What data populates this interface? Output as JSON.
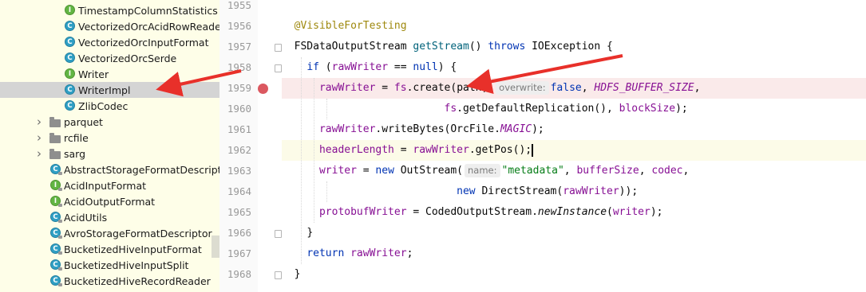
{
  "project_tree": {
    "items": [
      {
        "label": "TimestampColumnStatistics",
        "icon": "interface-icon",
        "badge": "I"
      },
      {
        "label": "VectorizedOrcAcidRowReader",
        "icon": "class-icon",
        "badge": "C"
      },
      {
        "label": "VectorizedOrcInputFormat",
        "icon": "class-icon",
        "badge": "C"
      },
      {
        "label": "VectorizedOrcSerde",
        "icon": "class-icon",
        "badge": "C"
      },
      {
        "label": "Writer",
        "icon": "interface-icon",
        "badge": "I"
      },
      {
        "label": "WriterImpl",
        "icon": "class-icon",
        "badge": "C",
        "selected": true
      },
      {
        "label": "ZlibCodec",
        "icon": "class-icon",
        "badge": "C"
      },
      {
        "label": "parquet",
        "icon": "folder-icon"
      },
      {
        "label": "rcfile",
        "icon": "folder-icon"
      },
      {
        "label": "sarg",
        "icon": "folder-icon"
      },
      {
        "label": "AbstractStorageFormatDescriptor",
        "icon": "class-icon",
        "badge": "C"
      },
      {
        "label": "AcidInputFormat",
        "icon": "interface-icon",
        "badge": "I"
      },
      {
        "label": "AcidOutputFormat",
        "icon": "interface-icon",
        "badge": "I"
      },
      {
        "label": "AcidUtils",
        "icon": "class-icon",
        "badge": "C"
      },
      {
        "label": "AvroStorageFormatDescriptor",
        "icon": "class-icon",
        "badge": "C"
      },
      {
        "label": "BucketizedHiveInputFormat",
        "icon": "class-icon",
        "badge": "C"
      },
      {
        "label": "BucketizedHiveInputSplit",
        "icon": "class-icon",
        "badge": "C"
      },
      {
        "label": "BucketizedHiveRecordReader",
        "icon": "class-icon",
        "badge": "C"
      }
    ]
  },
  "editor": {
    "line_numbers": [
      "1955",
      "1956",
      "1957",
      "1958",
      "1959",
      "1960",
      "1961",
      "1962",
      "1963",
      "1964",
      "1965",
      "1966",
      "1967",
      "1968"
    ],
    "breakpoint_line": "1959",
    "code": {
      "l1956_annotation": "@VisibleForTesting",
      "l1957_type": "FSDataOutputStream ",
      "l1957_method": "getStream",
      "l1957_parens": "() ",
      "l1957_throws": "throws",
      "l1957_rest": " IOException {",
      "l1958_if": "if",
      "l1958_open": " (",
      "l1958_field": "rawWriter",
      "l1958_eq": " == ",
      "l1958_null": "null",
      "l1958_close": ") {",
      "l1959_field": "rawWriter",
      "l1959_assign": " = ",
      "l1959_fs": "fs",
      "l1959_call": ".create(",
      "l1959_arg": "path,",
      "l1959_hint": "overwrite:",
      "l1959_false": "false",
      "l1959_comma": ", ",
      "l1959_const": "HDFS_BUFFER_SIZE",
      "l1959_end": ",",
      "l1960_fs": "fs",
      "l1960_rest": ".getDefaultReplication(), ",
      "l1960_field": "blockSize",
      "l1960_end": ");",
      "l1961_field": "rawWriter",
      "l1961_rest": ".writeBytes(OrcFile.",
      "l1961_const": "MAGIC",
      "l1961_end": ");",
      "l1962_field": "headerLength",
      "l1962_assign": " = ",
      "l1962_field2": "rawWriter",
      "l1962_rest": ".getPos();",
      "l1963_field": "writer",
      "l1963_assign": " = ",
      "l1963_new": "new",
      "l1963_cls": " OutStream(",
      "l1963_hint": "name:",
      "l1963_str": "\"metadata\"",
      "l1963_comma": ", ",
      "l1963_buf": "bufferSize",
      "l1963_comma2": ", ",
      "l1963_codec": "codec",
      "l1963_end": ",",
      "l1964_new": "new",
      "l1964_cls": " DirectStream(",
      "l1964_field": "rawWriter",
      "l1964_end": "));",
      "l1965_field": "protobufWriter",
      "l1965_assign": " = CodedOutputStream.",
      "l1965_method": "newInstance",
      "l1965_open": "(",
      "l1965_field2": "writer",
      "l1965_end": ");",
      "l1966_brace": "}",
      "l1967_return": "return",
      "l1967_field": " rawWriter",
      "l1967_end": ";",
      "l1968_brace": "}"
    }
  },
  "colors": {
    "tree_background": "#fefee8",
    "selection": "#d4d4d4",
    "breakpoint": "#db5860",
    "annotation_arrow": "#e8302a"
  }
}
